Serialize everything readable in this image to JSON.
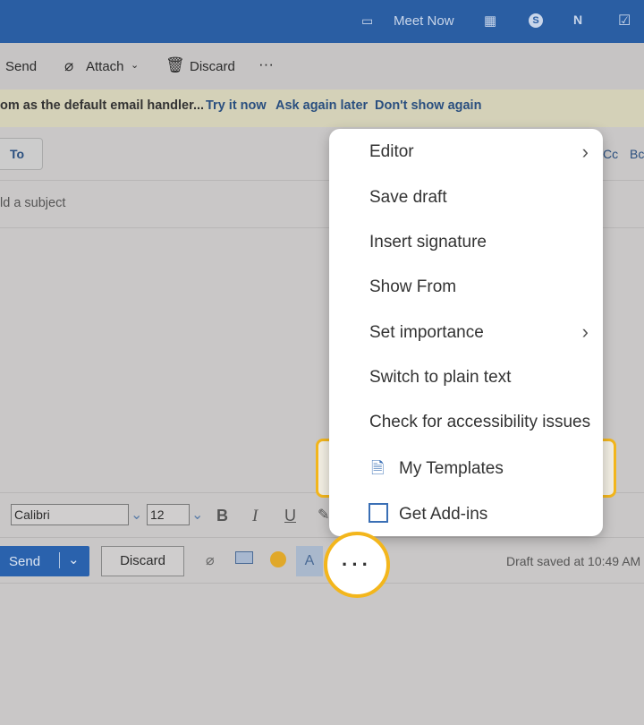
{
  "topbar": {
    "meet_now": "Meet Now"
  },
  "cmdbar": {
    "send": "Send",
    "attach": "Attach",
    "discard": "Discard",
    "more": "···"
  },
  "banner": {
    "text": "om as the default email handler...",
    "try": "Try it now",
    "later": "Ask again later",
    "never": "Don't show again"
  },
  "compose": {
    "to": "To",
    "cc": "Cc",
    "bcc": "Bc",
    "subject_placeholder": "ld a subject"
  },
  "format": {
    "font": "Calibri",
    "size": "12",
    "bold": "B",
    "italic": "I",
    "underline": "U"
  },
  "footer": {
    "send": "Send",
    "discard": "Discard",
    "more": "···",
    "status": "Draft saved at 10:49 AM"
  },
  "menu": {
    "items": [
      {
        "label": "Editor",
        "submenu": true
      },
      {
        "label": "Save draft"
      },
      {
        "label": "Insert signature"
      },
      {
        "label": "Show From"
      },
      {
        "label": "Set importance",
        "submenu": true
      },
      {
        "label": "Switch to plain text"
      },
      {
        "label": "Check for accessibility issues"
      },
      {
        "label": "My Templates"
      },
      {
        "label": "Get Add-ins"
      }
    ]
  },
  "colors": {
    "brand": "#2a5ea3",
    "highlight": "#f3b61c"
  }
}
